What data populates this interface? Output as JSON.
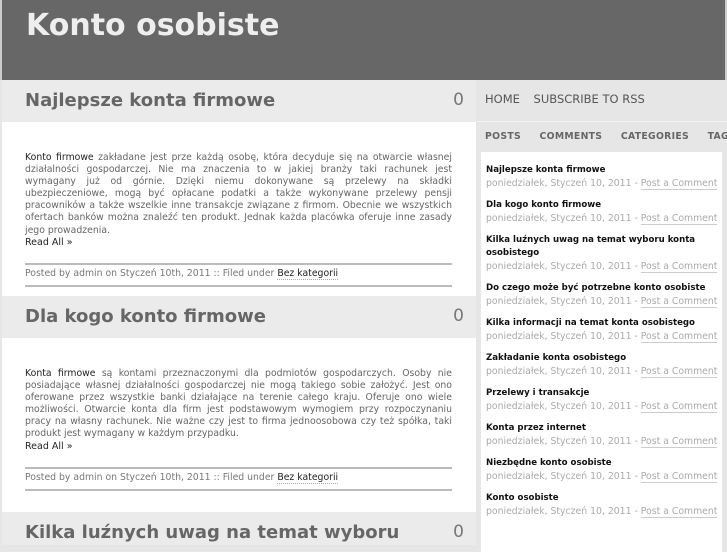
{
  "site_title": "Konto osobiste",
  "nav": [
    "HOME",
    "SUBSCRIBE TO RSS"
  ],
  "tabs": [
    "POSTS",
    "COMMENTS",
    "CATEGORIES",
    "TAGS"
  ],
  "posts": [
    {
      "title": "Najlepsze konta firmowe",
      "count": "0",
      "lead": "Konto firmowe",
      "text": " zakładane jest prze każdą osobę, która decyduje się na otwarcie własnej działalności gospodarczej. Nie ma znaczenia to w jakiej branży taki rachunek jest wymagany już od górnie. Dzięki niemu dokonywane są przelewy na składki ubezpieczeniowe, mogą być opłacane podatki a także wykonywane przelewy pensji pracowników a także wszelkie inne transakcje związane z firmom. Obecnie we wszystkich ofertach banków można znaleźć ten produkt. Jednak każda placówka oferuje inne zasady jego prowadzenia.",
      "read_all": "Read All »",
      "meta": "Posted by admin on Styczeń 10th, 2011 :: Filed under ",
      "category": "Bez kategorii"
    },
    {
      "title": "Dla kogo konto firmowe",
      "count": "0",
      "lead": "Konta firmowe",
      "text": " są kontami przeznaczonymi dla podmiotów gospodarczych. Osoby nie posiadające własnej działalności gospodarczej nie mogą takiego sobie założyć. Jest ono oferowane przez wszystkie banki działające na terenie całego kraju. Oferuje ono wiele możliwości. Otwarcie konta dla firm jest podstawowym wymogiem przy rozpoczynaniu pracy na własny rachunek. Nie ważne czy jest to firma jednoosobowa czy też spółka, taki produkt jest wymagany w każdym przypadku.",
      "read_all": "Read All »",
      "meta": "Posted by admin on Styczeń 10th, 2011 :: Filed under ",
      "category": "Bez kategorii"
    },
    {
      "title": "Kilka luźnych uwag na temat wyboru konta osobistego",
      "count": "0"
    }
  ],
  "recent_date": "poniedziałek, Styczeń 10, 2011 - ",
  "recent_link": "Post a Comment",
  "recent": [
    "Najlepsze konta firmowe",
    "Dla kogo konto firmowe",
    "Kilka luźnych uwag na temat wyboru konta osobistego",
    "Do czego może być potrzebne konto osobiste",
    "Kilka informacji na temat konta osobistego",
    "Zakładanie konta osobistego",
    "Przelewy i transakcje",
    "Konta przez internet",
    "Niezbędne konto osobiste",
    "Konto osobiste"
  ]
}
